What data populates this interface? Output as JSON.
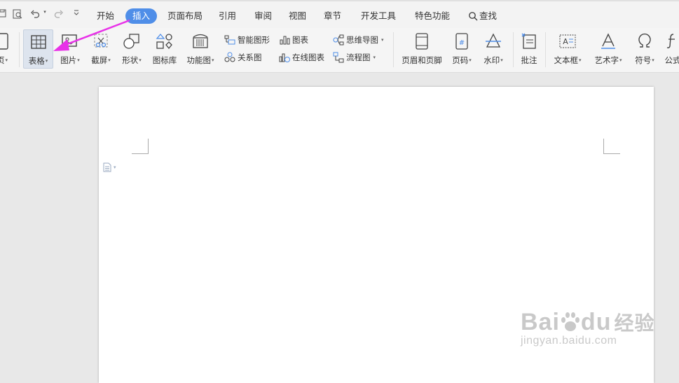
{
  "menu": {
    "tabs": [
      "开始",
      "插入",
      "页面布局",
      "引用",
      "审阅",
      "视图",
      "章节",
      "开发工具",
      "特色功能"
    ],
    "active_tab": "插入",
    "search_label": "查找"
  },
  "ribbon": {
    "left_partial_label": "页",
    "table_label": "表格",
    "picture_label": "图片",
    "screenshot_label": "截屏",
    "shape_label": "形状",
    "icon_lib_label": "图标库",
    "function_chart_label": "功能图",
    "smart_graphic_label": "智能图形",
    "chart_label": "图表",
    "mindmap_label": "思维导图",
    "relation_label": "关系图",
    "online_chart_label": "在线图表",
    "flowchart_label": "流程图",
    "header_footer_label": "页眉和页脚",
    "page_number_label": "页码",
    "watermark_label": "水印",
    "comment_label": "批注",
    "textbox_label": "文本框",
    "wordart_label": "艺术字",
    "symbol_label": "符号",
    "formula_partial_label": "公式"
  },
  "watermark": {
    "brand": "Bai",
    "brand_end": "du",
    "cn": "经验",
    "url": "jingyan.baidu.com"
  },
  "colors": {
    "accent": "#4f8ee8",
    "annotation_arrow": "#e832e8"
  }
}
